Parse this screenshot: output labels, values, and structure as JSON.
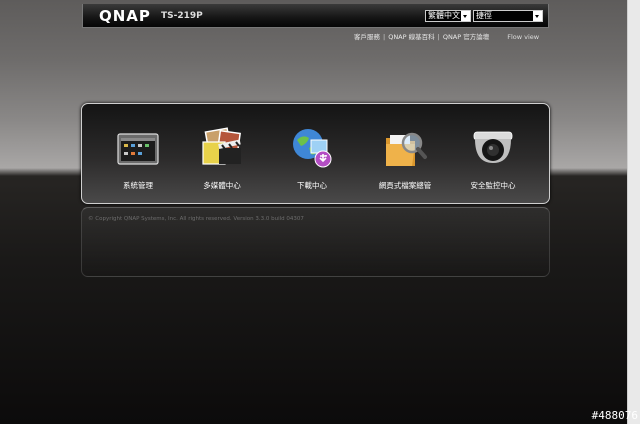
{
  "header": {
    "logo": "QNAP",
    "model": "TS-219P",
    "language_select": {
      "value": "繁體中文"
    },
    "search_select": {
      "value": "捷徑"
    }
  },
  "links": {
    "items": [
      "客戶服務",
      "QNAP 線基百科",
      "QNAP 官方論壇"
    ],
    "separator": "|",
    "flow_view": "Flow view"
  },
  "tiles": [
    {
      "label": "系統管理",
      "icon": "system-admin-icon"
    },
    {
      "label": "多媒體中心",
      "icon": "multimedia-icon"
    },
    {
      "label": "下載中心",
      "icon": "download-center-icon"
    },
    {
      "label": "網頁式檔案總管",
      "icon": "web-file-manager-icon"
    },
    {
      "label": "安全監控中心",
      "icon": "surveillance-camera-icon"
    }
  ],
  "footer": {
    "copyright": "© Copyright QNAP Systems, Inc. All rights reserved. Version 3.3.0 build 04307"
  },
  "watermark": "#488076"
}
